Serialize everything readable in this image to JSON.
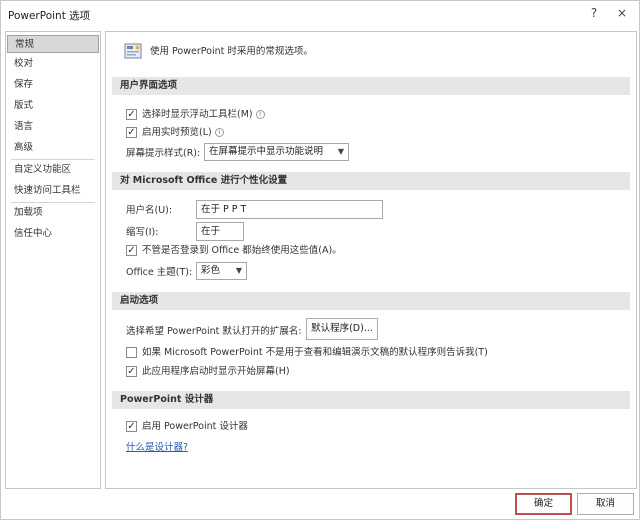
{
  "window": {
    "title": "PowerPoint 选项",
    "help_glyph": "?",
    "close_glyph": "×"
  },
  "sidebar": {
    "items": [
      {
        "label": "常规",
        "active": true
      },
      {
        "label": "校对"
      },
      {
        "label": "保存"
      },
      {
        "label": "版式"
      },
      {
        "label": "语言"
      },
      {
        "label": "高级"
      },
      {
        "label": "自定义功能区"
      },
      {
        "label": "快速访问工具栏"
      },
      {
        "label": "加载项"
      },
      {
        "label": "信任中心"
      }
    ]
  },
  "intro": {
    "icon": "general-options-icon",
    "text": "使用 PowerPoint 时采用的常规选项。"
  },
  "ui_section": {
    "header": "用户界面选项",
    "mini_toolbar": {
      "label": "选择时显示浮动工具栏(M)",
      "checked": true
    },
    "live_preview": {
      "label": "启用实时预览(L)",
      "checked": true
    },
    "tooltip_style_label": "屏幕提示样式(R):",
    "tooltip_style_value": "在屏幕提示中显示功能说明"
  },
  "personalize_section": {
    "header": "对 Microsoft Office 进行个性化设置",
    "username_label": "用户名(U):",
    "username_value": "在于 P P T",
    "initials_label": "缩写(I):",
    "initials_value": "在于",
    "always_use": {
      "label": "不管是否登录到 Office 都始终使用这些值(A)。",
      "checked": true
    },
    "theme_label": "Office 主题(T):",
    "theme_value": "彩色"
  },
  "startup_section": {
    "header": "启动选项",
    "default_ext_label": "选择希望 PowerPoint 默认打开的扩展名:",
    "default_programs_button": "默认程序(D)...",
    "tell_me": {
      "label": "如果 Microsoft PowerPoint 不是用于查看和编辑演示文稿的默认程序则告诉我(T)",
      "checked": false
    },
    "show_start": {
      "label": "此应用程序启动时显示开始屏幕(H)",
      "checked": true
    }
  },
  "designer_section": {
    "header": "PowerPoint 设计器",
    "enable": {
      "label": "启用 PowerPoint 设计器",
      "checked": true
    },
    "link": "什么是设计器?"
  },
  "footer": {
    "ok_label": "确定",
    "cancel_label": "取消"
  },
  "colors": {
    "section_header_bg": "#e6e6e6",
    "active_nav_bg": "#d8d8d8",
    "ok_border": "#c0504d",
    "link": "#2a5ab3"
  }
}
